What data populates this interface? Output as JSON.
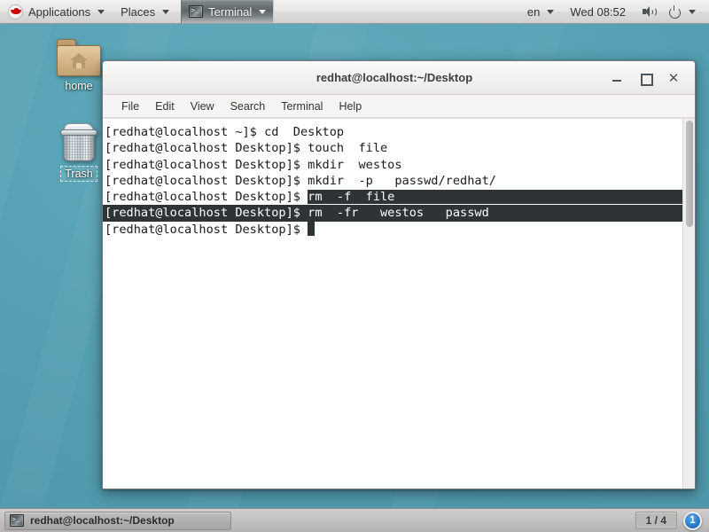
{
  "top_panel": {
    "logo_icon": "redhat-shadowman-icon",
    "applications_label": "Applications",
    "places_label": "Places",
    "window_item_label": "Terminal",
    "window_item_icon": "terminal-icon",
    "keyboard_layout": "en",
    "clock": "Wed 08:52",
    "volume_icon": "speaker-icon",
    "power_icon": "power-icon"
  },
  "desktop": {
    "icons": [
      {
        "label": "home",
        "icon": "home-folder-icon",
        "selected": false
      },
      {
        "label": "Trash",
        "icon": "trash-icon",
        "selected": true
      }
    ]
  },
  "terminal": {
    "title": "redhat@localhost:~/Desktop",
    "buttons": {
      "minimize": "_",
      "maximize": "□",
      "close": "✕"
    },
    "menu": [
      "File",
      "Edit",
      "View",
      "Search",
      "Terminal",
      "Help"
    ],
    "lines": [
      {
        "prompt": "[redhat@localhost ~]$ ",
        "command": "cd  Desktop",
        "selection": "none"
      },
      {
        "prompt": "[redhat@localhost Desktop]$ ",
        "command": "touch  file",
        "selection": "none"
      },
      {
        "prompt": "[redhat@localhost Desktop]$ ",
        "command": "mkdir  westos",
        "selection": "none"
      },
      {
        "prompt": "[redhat@localhost Desktop]$ ",
        "command": "mkdir  -p   passwd/redhat/",
        "selection": "none"
      },
      {
        "prompt": "[redhat@localhost Desktop]$ ",
        "command": "rm  -f  file",
        "selection": "command"
      },
      {
        "prompt": "[redhat@localhost Desktop]$ ",
        "command": "rm  -fr   westos   passwd",
        "selection": "full"
      },
      {
        "prompt": "[redhat@localhost Desktop]$ ",
        "command": "",
        "selection": "cursor"
      }
    ]
  },
  "bottom_panel": {
    "task_label": "redhat@localhost:~/Desktop",
    "task_icon": "terminal-icon",
    "workspace_count_label": "1 / 4",
    "workspace_current": "1"
  },
  "colors": {
    "desktop_bg": "#58a2b5",
    "selection_bg": "#2e3436",
    "selection_fg": "#ffffff",
    "accent_blue": "#2a7ac4",
    "redhat_red": "#cc0000"
  }
}
